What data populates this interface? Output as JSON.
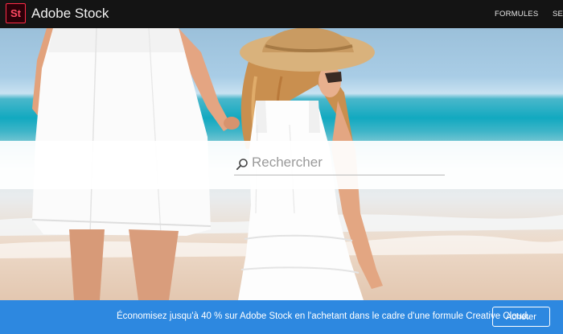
{
  "app": {
    "logo_text": "St",
    "brand": "Adobe Stock"
  },
  "nav": {
    "formules": "FORMULES",
    "se_partial": "SE C"
  },
  "search": {
    "placeholder": "Rechercher"
  },
  "promo": {
    "text": "Économisez jusqu'à 40 % sur Adobe Stock en l'achetant dans le cadre d'une formule Creative Cloud.",
    "button_label": "Acheter"
  },
  "colors": {
    "topbar": "#141414",
    "logo_accent": "#ff2a46",
    "promo_blue": "#2d88e0"
  },
  "icons": {
    "logo": "adobe-stock-logo",
    "search": "search-icon"
  }
}
